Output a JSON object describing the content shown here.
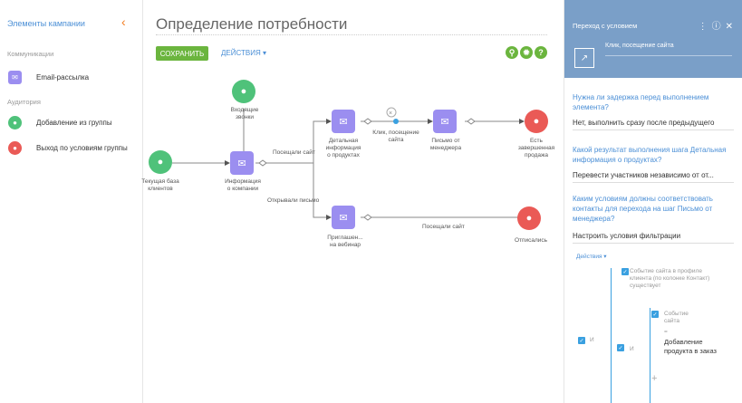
{
  "left_panel": {
    "title": "Элементы кампании",
    "sections": [
      {
        "label": "Коммуникации",
        "items": [
          {
            "label": "Email-рассылка",
            "icon": "envelope-icon"
          }
        ]
      },
      {
        "label": "Аудитория",
        "items": [
          {
            "label": "Добавление из группы",
            "icon": "user-add-icon"
          },
          {
            "label": "Выход по условиям группы",
            "icon": "user-exit-icon"
          }
        ]
      }
    ]
  },
  "header": {
    "title": "Определение потребности",
    "save_label": "СОХРАНИТЬ",
    "actions_label": "ДЕЙСТВИЯ ▾"
  },
  "diagram": {
    "nodes": {
      "incoming_calls": "Входящие\nзвонки",
      "current_base": "Текущая база\nклиентов",
      "company_info": "Информация\nо компании",
      "product_details": "Детальная\nинформация\nо продуктах",
      "manager_letter": "Письмо от\nменеджера",
      "sale_done": "Есть\nзавершенная\nпродажа",
      "webinar": "Приглашен...\nна вебинар",
      "unsubscribed": "Отписались"
    },
    "edges": {
      "visited_site_1": "Посещали сайт",
      "opened_letter": "Открывали письмо",
      "click_visit": "Клик, посещение\nсайта",
      "visited_site_2": "Посещали сайт"
    }
  },
  "right_panel": {
    "title": "Переход с условием",
    "subtitle": "Клик, посещение сайта",
    "q1": "Нужна ли задержка перед выполнением элемента?",
    "a1": "Нет, выполнить сразу после предыдущего",
    "q2": "Какой результат выполнения шага Детальная информация о продуктах?",
    "a2": "Перевести участников независимо от от...",
    "q3": "Каким условиям должны соответствовать контакты для перехода на шаг Письмо от менеджера?",
    "a3": "Настроить условия фильтрации",
    "actions": "Действия ▾",
    "filter": {
      "and1": "И",
      "and2": "И",
      "cond1": "Событие сайта в профиле клиента (по колонке Контакт) существует",
      "cond2_a": "Событие сайта",
      "cond2_op": "=",
      "cond2_b": "Добавление продукта в заказ"
    }
  },
  "colors": {
    "accent": "#4b8fd6",
    "save": "#6bb53e",
    "email_node": "#9b8ef0",
    "audience_in": "#4fc27a",
    "audience_out": "#ea5a56",
    "panel_head": "#7a9fc8"
  }
}
